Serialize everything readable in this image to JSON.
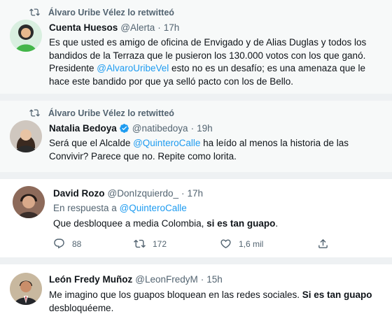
{
  "colors": {
    "link": "#1d9bf0",
    "muted": "#536471",
    "text": "#0f1419",
    "separator": "#e1e6ea"
  },
  "tweets": [
    {
      "retweet_label": "Álvaro Uribe Vélez lo retwitteó",
      "name": "Cuenta Huesos",
      "handle": "@Alerta",
      "dot": "·",
      "time": "17h",
      "text_1": "Es que usted es amigo de oficina de Envigado y de Alias Duglas y todos los bandidos de la Terraza que le pusieron los 130.000 votos con los que ganó. Presidente ",
      "mention_1": "@AlvaroUribeVel",
      "text_2": " esto no es un desafío; es una amenaza que le hace este bandido por que ya selló pacto con los de Bello.",
      "avatar_icon": "avatar-woman-green-icon"
    },
    {
      "retweet_label": "Álvaro Uribe Vélez lo retwitteó",
      "name": "Natalia Bedoya",
      "handle": "@natibedoya",
      "dot": "·",
      "time": "19h",
      "verified_icon": "verified-badge-icon",
      "text_1": "Será que el Alcalde ",
      "mention_1": "@QuinteroCalle",
      "text_2": " ha leído al menos la historia de las Convivir? Parece que no. Repite como lorita.",
      "avatar_icon": "avatar-woman-icon"
    },
    {
      "name": "David Rozo",
      "handle": "@DonIzquierdo_",
      "dot": "·",
      "time": "17h",
      "reply_prefix": "En respuesta a ",
      "reply_mention": "@QuinteroCalle",
      "text_1": "Que desbloquee a media Colombia, ",
      "bold_1": "si es tan guapo",
      "text_2": ".",
      "avatar_icon": "avatar-man-icon",
      "actions": {
        "replies": "88",
        "retweets": "172",
        "likes": "1,6 mil"
      }
    },
    {
      "name": "León Fredy Muñoz",
      "handle": "@LeonFredyM",
      "dot": "·",
      "time": "15h",
      "text_1": "Me imagino que los guapos bloquean en las redes sociales. ",
      "bold_1": "Si es tan guapo",
      "text_2": " desbloquéeme.",
      "avatar_icon": "avatar-man-suit-icon"
    }
  ]
}
